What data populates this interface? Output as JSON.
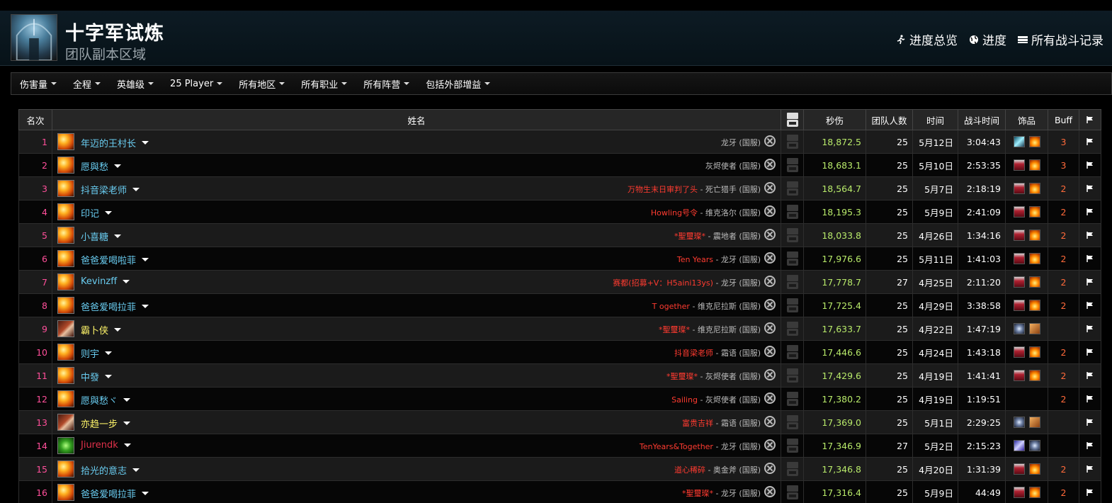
{
  "header": {
    "title": "十字军试炼",
    "subtitle": "团队副本区域",
    "links": [
      "进度总览",
      "进度",
      "所有战斗记录"
    ]
  },
  "filters": [
    "伤害量",
    "全程",
    "英雄级",
    "25 Player",
    "所有地区",
    "所有职业",
    "所有阵营",
    "包括外部增益"
  ],
  "table": {
    "headers": {
      "rank": "名次",
      "name": "姓名",
      "dps": "秒伤",
      "raid_size": "团队人数",
      "date": "时间",
      "duration": "战斗时间",
      "trinkets": "饰品",
      "buff": "Buff"
    },
    "rows": [
      {
        "rank": "1",
        "name": "年迈的王村长",
        "class": "mage",
        "guild": "",
        "server": "龙牙 (国服)",
        "dps": "18,872.5",
        "raid_size": "25",
        "date": "5月12日",
        "duration": "3:04:43",
        "trinkets": [
          "crystal",
          "flame"
        ],
        "buff": "3"
      },
      {
        "rank": "2",
        "name": "愿與愁",
        "class": "mage",
        "guild": "",
        "server": "灰烬使者 (国服)",
        "dps": "18,683.1",
        "raid_size": "25",
        "date": "5月10日",
        "duration": "2:53:35",
        "trinkets": [
          "red",
          "flame"
        ],
        "buff": "3"
      },
      {
        "rank": "3",
        "name": "抖音梁老师",
        "class": "mage",
        "guild": "万物生末日审判了头",
        "server": " - 死亡猎手 (国服)",
        "dps": "18,564.7",
        "raid_size": "25",
        "date": "5月7日",
        "duration": "2:18:19",
        "trinkets": [
          "red",
          "flame"
        ],
        "buff": "2"
      },
      {
        "rank": "4",
        "name": "印记",
        "class": "mage",
        "guild": "Howling号令",
        "server": " - 维克洛尔 (国服)",
        "dps": "18,195.3",
        "raid_size": "25",
        "date": "5月9日",
        "duration": "2:41:09",
        "trinkets": [
          "red",
          "flame"
        ],
        "buff": "2"
      },
      {
        "rank": "5",
        "name": "小喜糖",
        "class": "mage",
        "guild": "*聖璽璨*",
        "server": " - 震地者 (国服)",
        "dps": "18,033.8",
        "raid_size": "25",
        "date": "4月26日",
        "duration": "1:34:16",
        "trinkets": [
          "red",
          "flame"
        ],
        "buff": "2"
      },
      {
        "rank": "6",
        "name": "爸爸爱喝啦菲",
        "class": "mage",
        "guild": "Ten Years",
        "server": " - 龙牙 (国服)",
        "dps": "17,976.6",
        "raid_size": "25",
        "date": "5月11日",
        "duration": "1:41:03",
        "trinkets": [
          "red",
          "flame"
        ],
        "buff": "2"
      },
      {
        "rank": "7",
        "name": "Kevinzff",
        "class": "mage",
        "guild": "赛都(招募+V：H5aini13ys)",
        "server": " - 龙牙 (国服)",
        "dps": "17,778.7",
        "raid_size": "27",
        "date": "4月25日",
        "duration": "2:11:20",
        "trinkets": [
          "red",
          "flame"
        ],
        "buff": "2"
      },
      {
        "rank": "8",
        "name": "爸爸爱喝拉菲",
        "class": "mage",
        "guild": "T ogether",
        "server": " - 维克尼拉斯 (国服)",
        "dps": "17,725.4",
        "raid_size": "25",
        "date": "4月29日",
        "duration": "3:38:58",
        "trinkets": [
          "red",
          "flame"
        ],
        "buff": "2"
      },
      {
        "rank": "9",
        "name": "霸卜侠",
        "class": "rogue",
        "guild": "*聖璽璨*",
        "server": " - 维克尼拉斯 (国服)",
        "dps": "17,633.7",
        "raid_size": "25",
        "date": "4月22日",
        "duration": "1:47:19",
        "trinkets": [
          "skull",
          "claw"
        ],
        "buff": ""
      },
      {
        "rank": "10",
        "name": "则宇",
        "class": "mage",
        "guild": "抖音梁老师",
        "server": " - 霜语 (国服)",
        "dps": "17,446.6",
        "raid_size": "25",
        "date": "4月24日",
        "duration": "1:43:18",
        "trinkets": [
          "red",
          "flame"
        ],
        "buff": "2"
      },
      {
        "rank": "11",
        "name": "中發",
        "class": "mage",
        "guild": "*聖璽璨*",
        "server": " - 灰烬使者 (国服)",
        "dps": "17,429.6",
        "raid_size": "25",
        "date": "4月19日",
        "duration": "1:41:41",
        "trinkets": [
          "red",
          "flame"
        ],
        "buff": "2"
      },
      {
        "rank": "12",
        "name": "愿與愁ヾ",
        "class": "mage",
        "guild": "Sailing",
        "server": " - 灰烬使者 (国服)",
        "dps": "17,380.2",
        "raid_size": "25",
        "date": "4月19日",
        "duration": "1:19:51",
        "trinkets": [],
        "buff": "2"
      },
      {
        "rank": "13",
        "name": "亦趋一步",
        "class": "rogue",
        "guild": "富贵吉祥",
        "server": " - 霜语 (国服)",
        "dps": "17,369.0",
        "raid_size": "25",
        "date": "5月1日",
        "duration": "2:29:25",
        "trinkets": [
          "skull",
          "claw"
        ],
        "buff": ""
      },
      {
        "rank": "14",
        "name": "Jiurendk",
        "class": "dk",
        "guild": "TenYears&Together",
        "server": " - 龙牙 (国服)",
        "dps": "17,346.9",
        "raid_size": "27",
        "date": "5月2日",
        "duration": "2:15:23",
        "trinkets": [
          "sword",
          "skull"
        ],
        "buff": ""
      },
      {
        "rank": "15",
        "name": "拾光的意志",
        "class": "mage",
        "guild": "道心稀碎",
        "server": " - 奥金斧 (国服)",
        "dps": "17,346.8",
        "raid_size": "25",
        "date": "4月20日",
        "duration": "1:31:39",
        "trinkets": [
          "red",
          "flame"
        ],
        "buff": "2"
      },
      {
        "rank": "16",
        "name": "爸爸爱喝拉菲",
        "class": "mage",
        "guild": "*聖璽璨*",
        "server": " - 龙牙 (国服)",
        "dps": "17,316.4",
        "raid_size": "25",
        "date": "5月9日",
        "duration": "44:49",
        "trinkets": [
          "red",
          "flame"
        ],
        "buff": "2"
      }
    ]
  },
  "colors": {
    "rank": "#ff4f9a",
    "mage": "#69ccf0",
    "rogue": "#fff569",
    "death_knight": "#e0314a",
    "guild": "#ff3b30",
    "dps": "#b8ea6a",
    "buff": "#ff6a3a"
  }
}
